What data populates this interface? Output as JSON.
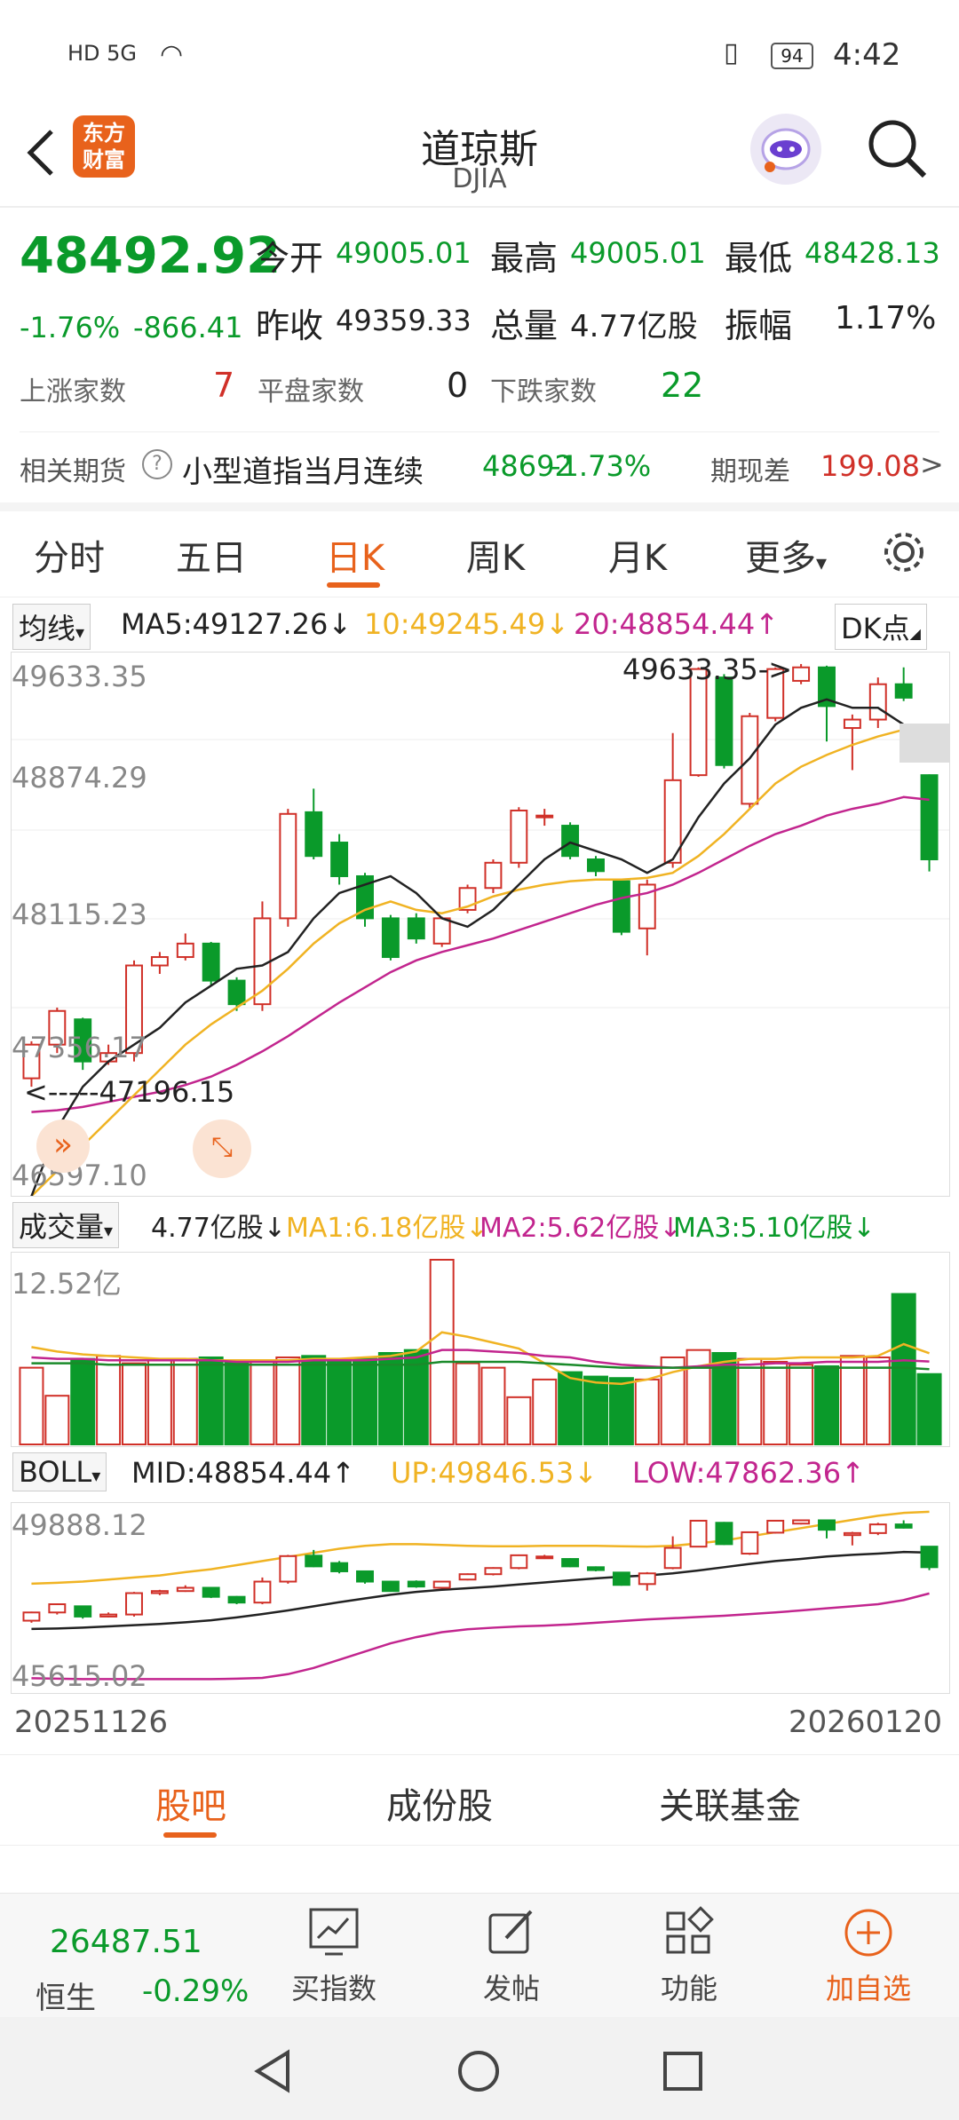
{
  "status": {
    "left_icons": "HD 5G",
    "battery": "94",
    "time": "4:42"
  },
  "header": {
    "title": "道琼斯",
    "subtitle": "DJIA",
    "logo_text_1": "东方",
    "logo_text_2": "财富"
  },
  "quote": {
    "price": "48492.92",
    "change_pct": "-1.76%",
    "change": "-866.41",
    "open_label": "今开",
    "open": "49005.01",
    "high_label": "最高",
    "high": "49005.01",
    "low_label": "最低",
    "low": "48428.13",
    "prev_label": "昨收",
    "prev": "49359.33",
    "vol_label": "总量",
    "vol": "4.77亿股",
    "amp_label": "振幅",
    "amp": "1.17%",
    "up_label": "上涨家数",
    "up": "7",
    "flat_label": "平盘家数",
    "flat": "0",
    "down_label": "下跌家数",
    "down": "22"
  },
  "futures": {
    "label": "相关期货",
    "help": "?",
    "name": "小型道指当月连续",
    "price": "48692",
    "pct": "-1.73%",
    "basis_label": "期现差",
    "basis": "199.08",
    "arrow": ">"
  },
  "tabs": [
    "分时",
    "五日",
    "日K",
    "周K",
    "月K",
    "更多"
  ],
  "tab_more_arrow": "▾",
  "ma_legend": {
    "select": "均线",
    "ma5": "MA5:49127.26",
    "ma5_arrow": "↓",
    "ma10": "10:49245.49",
    "ma10_arrow": "↓",
    "ma20": "20:48854.44",
    "ma20_arrow": "↑",
    "dk": "DK点"
  },
  "kline_axis": {
    "y1": "49633.35",
    "y2": "48874.29",
    "y3": "48115.23",
    "y4": "47356.17",
    "y5": "46597.10",
    "max_mark": "49633.35->",
    "min_mark": "<-----47196.15"
  },
  "vol_legend": {
    "select": "成交量",
    "vol": "4.77亿股",
    "vol_arrow": "↓",
    "ma1": "MA1:6.18亿股",
    "ma1_arrow": "↓",
    "ma2": "MA2:5.62亿股",
    "ma2_arrow": "↓",
    "ma3": "MA3:5.10亿股",
    "ma3_arrow": "↓",
    "ymax": "12.52亿"
  },
  "boll_legend": {
    "select": "BOLL",
    "mid": "MID:48854.44",
    "mid_arrow": "↑",
    "up": "UP:49846.53",
    "up_arrow": "↓",
    "low": "LOW:47862.36",
    "low_arrow": "↑",
    "y_top": "49888.12",
    "y_bottom": "45615.02"
  },
  "dates": {
    "start": "20251126",
    "end": "20260120"
  },
  "bottom_tabs": [
    "股吧",
    "成份股",
    "关联基金"
  ],
  "bottom_nav": {
    "hs_price": "26487.51",
    "hs_name": "恒生",
    "hs_pct": "-0.29%",
    "buy": "买指数",
    "post": "发帖",
    "func": "功能",
    "add": "加自选"
  },
  "colors": {
    "up": "#d03028",
    "down": "#0a9a2a",
    "ma5": "#222222",
    "ma10": "#f0b323",
    "ma20": "#c2258e",
    "accent": "#e8621c"
  },
  "chart_data": {
    "type": "candlestick",
    "x_range": [
      "20251126",
      "20260120"
    ],
    "ylim": [
      46597.1,
      49633.35
    ],
    "candles": [
      {
        "o": 47200,
        "c": 47400,
        "h": 47420,
        "l": 47150
      },
      {
        "o": 47400,
        "c": 47600,
        "h": 47620,
        "l": 47350
      },
      {
        "o": 47550,
        "c": 47300,
        "h": 47560,
        "l": 47250
      },
      {
        "o": 47300,
        "c": 47350,
        "h": 47400,
        "l": 47280
      },
      {
        "o": 47350,
        "c": 47870,
        "h": 47900,
        "l": 47300
      },
      {
        "o": 47870,
        "c": 47920,
        "h": 47950,
        "l": 47820
      },
      {
        "o": 47920,
        "c": 48000,
        "h": 48060,
        "l": 47900
      },
      {
        "o": 48000,
        "c": 47780,
        "h": 48010,
        "l": 47750
      },
      {
        "o": 47780,
        "c": 47640,
        "h": 47800,
        "l": 47600
      },
      {
        "o": 47640,
        "c": 48150,
        "h": 48250,
        "l": 47600
      },
      {
        "o": 48150,
        "c": 48770,
        "h": 48800,
        "l": 48100
      },
      {
        "o": 48780,
        "c": 48520,
        "h": 48920,
        "l": 48500
      },
      {
        "o": 48600,
        "c": 48400,
        "h": 48650,
        "l": 48350
      },
      {
        "o": 48400,
        "c": 48150,
        "h": 48420,
        "l": 48100
      },
      {
        "o": 48150,
        "c": 47920,
        "h": 48170,
        "l": 47900
      },
      {
        "o": 48150,
        "c": 48030,
        "h": 48180,
        "l": 48000
      },
      {
        "o": 48000,
        "c": 48150,
        "h": 48160,
        "l": 47980
      },
      {
        "o": 48200,
        "c": 48330,
        "h": 48350,
        "l": 48180
      },
      {
        "o": 48330,
        "c": 48480,
        "h": 48500,
        "l": 48300
      },
      {
        "o": 48480,
        "c": 48790,
        "h": 48810,
        "l": 48450
      },
      {
        "o": 48760,
        "c": 48760,
        "h": 48800,
        "l": 48700
      },
      {
        "o": 48700,
        "c": 48520,
        "h": 48720,
        "l": 48500
      },
      {
        "o": 48500,
        "c": 48430,
        "h": 48520,
        "l": 48400
      },
      {
        "o": 48370,
        "c": 48070,
        "h": 48380,
        "l": 48050
      },
      {
        "o": 48090,
        "c": 48350,
        "h": 48380,
        "l": 47930
      },
      {
        "o": 48480,
        "c": 48970,
        "h": 49250,
        "l": 48450
      },
      {
        "o": 49000,
        "c": 49630,
        "h": 49640,
        "l": 48990
      },
      {
        "o": 49580,
        "c": 49060,
        "h": 49600,
        "l": 49040
      },
      {
        "o": 48830,
        "c": 49350,
        "h": 49370,
        "l": 48800
      },
      {
        "o": 49340,
        "c": 49630,
        "h": 49640,
        "l": 49320
      },
      {
        "o": 49560,
        "c": 49640,
        "h": 49660,
        "l": 49540
      },
      {
        "o": 49640,
        "c": 49410,
        "h": 49650,
        "l": 49200
      },
      {
        "o": 49280,
        "c": 49330,
        "h": 49360,
        "l": 49030
      },
      {
        "o": 49330,
        "c": 49540,
        "h": 49580,
        "l": 49280
      },
      {
        "o": 49540,
        "c": 49460,
        "h": 49640,
        "l": 49440
      },
      {
        "o": 49000,
        "c": 48500,
        "h": 49005,
        "l": 48428
      }
    ],
    "ma5": [
      46500,
      46900,
      47150,
      47300,
      47400,
      47500,
      47650,
      47750,
      47850,
      47870,
      47950,
      48150,
      48300,
      48350,
      48400,
      48300,
      48150,
      48100,
      48200,
      48350,
      48500,
      48600,
      48550,
      48500,
      48420,
      48500,
      48750,
      48950,
      49100,
      49300,
      49400,
      49450,
      49400,
      49400,
      49300,
      49130
    ],
    "ma10": [
      46500,
      46650,
      46800,
      46950,
      47100,
      47250,
      47400,
      47520,
      47620,
      47720,
      47850,
      48000,
      48120,
      48200,
      48250,
      48200,
      48180,
      48220,
      48280,
      48320,
      48350,
      48370,
      48380,
      48380,
      48390,
      48420,
      48520,
      48650,
      48800,
      48950,
      49050,
      49120,
      49180,
      49230,
      49270,
      49245
    ],
    "ma20": [
      47000,
      47010,
      47030,
      47060,
      47090,
      47120,
      47160,
      47210,
      47280,
      47360,
      47450,
      47550,
      47650,
      47740,
      47830,
      47900,
      47950,
      47990,
      48030,
      48080,
      48130,
      48180,
      48230,
      48270,
      48300,
      48350,
      48420,
      48500,
      48580,
      48650,
      48700,
      48760,
      48800,
      48830,
      48870,
      48854
    ],
    "volume": [
      5.2,
      3.3,
      5.8,
      6.0,
      5.5,
      5.8,
      5.8,
      5.9,
      5.6,
      5.6,
      5.9,
      6.0,
      5.8,
      5.8,
      6.2,
      6.4,
      12.52,
      5.5,
      5.2,
      3.2,
      4.4,
      4.9,
      4.6,
      4.5,
      4.4,
      5.9,
      6.4,
      6.2,
      5.8,
      5.6,
      5.4,
      5.3,
      6.0,
      5.9,
      10.2,
      4.77
    ],
    "vol_ylim": [
      0,
      12.52
    ],
    "vol_ma1": [
      6.6,
      6.3,
      6.1,
      6.0,
      5.9,
      5.8,
      5.8,
      5.7,
      5.7,
      5.7,
      5.7,
      5.8,
      5.8,
      5.9,
      6.0,
      6.3,
      7.6,
      7.3,
      6.9,
      6.5,
      5.5,
      4.5,
      4.2,
      4.1,
      4.4,
      4.9,
      5.3,
      5.6,
      5.8,
      5.8,
      5.9,
      5.9,
      5.9,
      6.0,
      6.8,
      6.18
    ],
    "vol_ma2": [
      5.9,
      5.8,
      5.8,
      5.7,
      5.7,
      5.7,
      5.7,
      5.7,
      5.6,
      5.6,
      5.6,
      5.7,
      5.7,
      5.7,
      5.8,
      5.9,
      6.4,
      6.4,
      6.3,
      6.2,
      6.0,
      5.9,
      5.6,
      5.4,
      5.3,
      5.2,
      5.3,
      5.4,
      5.4,
      5.5,
      5.5,
      5.6,
      5.6,
      5.6,
      5.7,
      5.62
    ],
    "vol_ma3": [
      5.5,
      5.5,
      5.5,
      5.4,
      5.4,
      5.4,
      5.4,
      5.4,
      5.4,
      5.4,
      5.4,
      5.4,
      5.4,
      5.4,
      5.4,
      5.4,
      5.6,
      5.6,
      5.6,
      5.6,
      5.5,
      5.4,
      5.3,
      5.2,
      5.2,
      5.2,
      5.2,
      5.2,
      5.2,
      5.2,
      5.2,
      5.2,
      5.2,
      5.2,
      5.2,
      5.1
    ],
    "boll_ylim": [
      45615.02,
      49888.12
    ],
    "boll_up": [
      48100,
      48120,
      48150,
      48200,
      48250,
      48300,
      48380,
      48450,
      48550,
      48650,
      48750,
      48850,
      48950,
      49020,
      49060,
      49060,
      49040,
      49020,
      49010,
      49010,
      49020,
      49020,
      49020,
      49010,
      49000,
      49020,
      49080,
      49150,
      49250,
      49350,
      49450,
      49550,
      49650,
      49750,
      49820,
      49847
    ],
    "boll_mid": [
      47000,
      47010,
      47030,
      47060,
      47090,
      47120,
      47160,
      47210,
      47280,
      47360,
      47450,
      47550,
      47650,
      47740,
      47830,
      47900,
      47950,
      47990,
      48030,
      48080,
      48130,
      48180,
      48230,
      48270,
      48300,
      48350,
      48420,
      48500,
      48580,
      48650,
      48700,
      48760,
      48800,
      48830,
      48870,
      48854
    ],
    "boll_low": [
      45800,
      45790,
      45780,
      45780,
      45780,
      45780,
      45780,
      45780,
      45790,
      45810,
      45900,
      46050,
      46250,
      46450,
      46650,
      46800,
      46920,
      46990,
      47030,
      47060,
      47080,
      47110,
      47150,
      47190,
      47230,
      47260,
      47290,
      47320,
      47360,
      47400,
      47450,
      47500,
      47550,
      47600,
      47700,
      47862
    ]
  }
}
